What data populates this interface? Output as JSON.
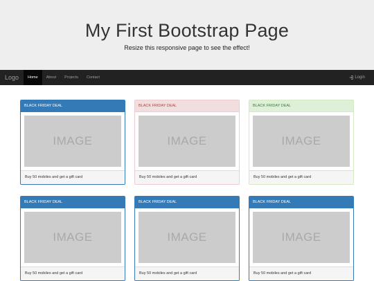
{
  "jumbotron": {
    "title": "My First Bootstrap Page",
    "subtitle": "Resize this responsive page to see the effect!"
  },
  "navbar": {
    "brand": "Logo",
    "items": [
      {
        "label": "Home",
        "active": true
      },
      {
        "label": "About"
      },
      {
        "label": "Projects"
      },
      {
        "label": "Contact"
      }
    ],
    "login_label": "Login"
  },
  "panels": [
    {
      "heading": "BLACK FRIDAY DEAL",
      "style": "primary",
      "image_text": "IMAGE",
      "footer": "Buy 50 mobiles and get a gift card"
    },
    {
      "heading": "BLACK FRIDAY DEAL",
      "style": "danger",
      "image_text": "IMAGE",
      "footer": "Buy 50 mobiles and get a gift card"
    },
    {
      "heading": "BLACK FRIDAY DEAL",
      "style": "success",
      "image_text": "IMAGE",
      "footer": "Buy 50 mobiles and get a gift card"
    },
    {
      "heading": "BLACK FRIDAY DEAL",
      "style": "primary",
      "image_text": "IMAGE",
      "footer": "Buy 50 mobiles and get a gift card"
    },
    {
      "heading": "BLACK FRIDAY DEAL",
      "style": "primary",
      "image_text": "IMAGE",
      "footer": "Buy 50 mobiles and get a gift card"
    },
    {
      "heading": "BLACK FRIDAY DEAL",
      "style": "primary",
      "image_text": "IMAGE",
      "footer": "Buy 50 mobiles and get a gift card"
    }
  ],
  "colors": {
    "primary": "#337ab7",
    "danger_bg": "#f2dede",
    "success_bg": "#dff0d8",
    "navbar_bg": "#222222",
    "jumbotron_bg": "#eeeeee"
  }
}
